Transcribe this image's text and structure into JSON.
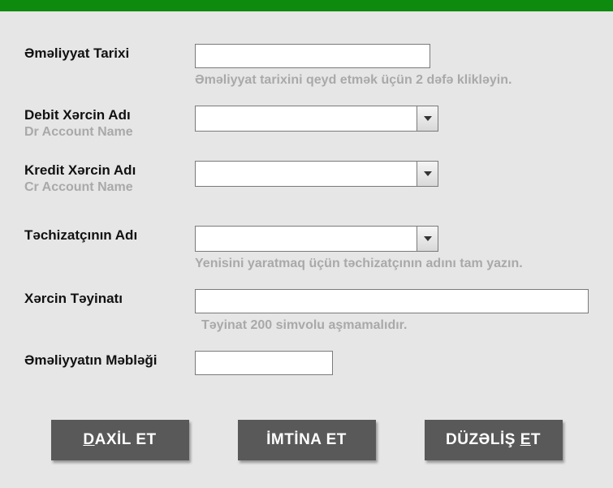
{
  "fields": {
    "transaction_date": {
      "label": "Əməliyyat Tarixi",
      "value": "",
      "hint": "Əməliyyat tarixini qeyd etmək üçün 2 dəfə klikləyin."
    },
    "debit_account": {
      "label": "Debit Xərcin Adı",
      "sublabel": "Dr Account Name",
      "value": ""
    },
    "credit_account": {
      "label": "Kredit Xərcin Adı",
      "sublabel": "Cr Account Name",
      "value": ""
    },
    "supplier_name": {
      "label": "Təchizatçının Adı",
      "value": "",
      "hint": "Yenisini yaratmaq üçün təchizatçının adını tam yazın."
    },
    "expense_purpose": {
      "label": "Xərcin Təyinatı",
      "value": "",
      "hint": "Təyinat 200 simvolu aşmamalıdır."
    },
    "transaction_amount": {
      "label": "Əməliyyatın Məbləği",
      "value": ""
    }
  },
  "buttons": {
    "enter_prefix": "D",
    "enter_rest": "AXİL ET",
    "cancel": "İMTİNA ET",
    "edit_prefix": "DÜZƏLİŞ ",
    "edit_under": "E",
    "edit_rest": "T"
  }
}
